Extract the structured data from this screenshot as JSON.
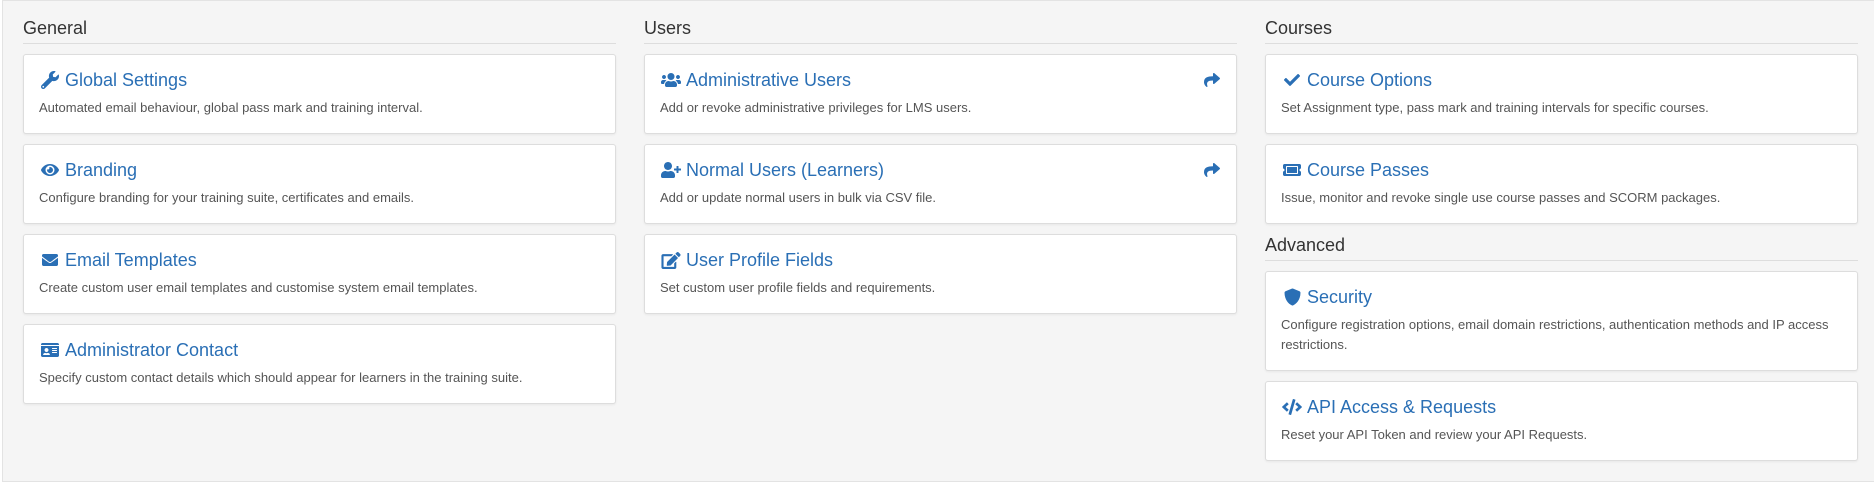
{
  "general": {
    "title": "General",
    "cards": [
      {
        "title": "Global Settings",
        "desc": "Automated email behaviour, global pass mark and training interval.",
        "icon": "wrench-icon"
      },
      {
        "title": "Branding",
        "desc": "Configure branding for your training suite, certificates and emails.",
        "icon": "eye-icon"
      },
      {
        "title": "Email Templates",
        "desc": "Create custom user email templates and customise system email templates.",
        "icon": "envelope-icon"
      },
      {
        "title": "Administrator Contact",
        "desc": "Specify custom contact details which should appear for learners in the training suite.",
        "icon": "id-card-icon"
      }
    ]
  },
  "users": {
    "title": "Users",
    "cards": [
      {
        "title": "Administrative Users",
        "desc": "Add or revoke administrative privileges for LMS users.",
        "icon": "users-icon"
      },
      {
        "title": "Normal Users (Learners)",
        "desc": "Add or update normal users in bulk via CSV file.",
        "icon": "user-plus-icon"
      },
      {
        "title": "User Profile Fields",
        "desc": "Set custom user profile fields and requirements.",
        "icon": "edit-icon"
      }
    ]
  },
  "courses": {
    "title": "Courses",
    "cards": [
      {
        "title": "Course Options",
        "desc": "Set Assignment type, pass mark and training intervals for specific courses.",
        "icon": "check-icon"
      },
      {
        "title": "Course Passes",
        "desc": "Issue, monitor and revoke single use course passes and SCORM packages.",
        "icon": "ticket-icon"
      }
    ]
  },
  "advanced": {
    "title": "Advanced",
    "cards": [
      {
        "title": "Security",
        "desc": "Configure registration options, email domain restrictions, authentication methods and IP access restrictions.",
        "icon": "shield-icon"
      },
      {
        "title": "API Access & Requests",
        "desc": "Reset your API Token and review your API Requests.",
        "icon": "code-icon"
      }
    ]
  },
  "colors": {
    "link": "#2a6fb5",
    "panel_bg": "#f5f5f5",
    "desc": "#555555"
  }
}
